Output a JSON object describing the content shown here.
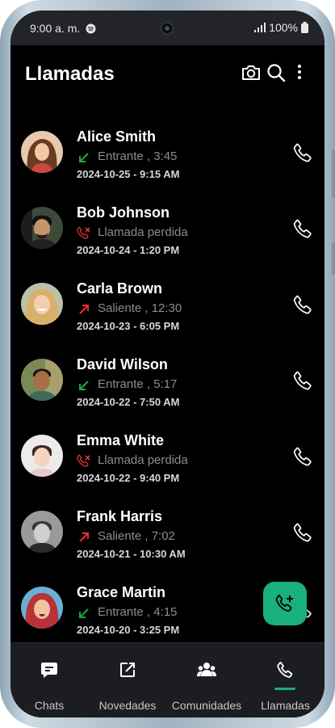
{
  "status_bar": {
    "time": "9:00 a. m.",
    "battery": "100%",
    "icons": [
      "spotify-icon",
      "signal-icon",
      "battery-icon"
    ]
  },
  "header": {
    "title": "Llamadas",
    "actions": [
      "camera-icon",
      "search-icon",
      "more-vert-icon"
    ]
  },
  "calls": [
    {
      "name": "Alice Smith",
      "direction": "incoming",
      "detail": "Entrante , 3:45",
      "datetime": "2024-10-25 - 9:15 AM"
    },
    {
      "name": "Bob Johnson",
      "direction": "missed",
      "detail": "Llamada perdida",
      "datetime": "2024-10-24 - 1:20 PM"
    },
    {
      "name": "Carla Brown",
      "direction": "outgoing",
      "detail": "Saliente , 12:30",
      "datetime": "2024-10-23 - 6:05 PM"
    },
    {
      "name": "David Wilson",
      "direction": "incoming",
      "detail": "Entrante , 5:17",
      "datetime": "2024-10-22 - 7:50 AM"
    },
    {
      "name": "Emma White",
      "direction": "missed",
      "detail": "Llamada perdida",
      "datetime": "2024-10-22 - 9:40 PM"
    },
    {
      "name": "Frank Harris",
      "direction": "outgoing",
      "detail": "Saliente , 7:02",
      "datetime": "2024-10-21 - 10:30 AM"
    },
    {
      "name": "Grace Martin",
      "direction": "incoming",
      "detail": "Entrante , 4:15",
      "datetime": "2024-10-20 - 3:25 PM"
    }
  ],
  "fab": {
    "icon": "add-call-icon"
  },
  "bottom_nav": [
    {
      "label": "Chats",
      "icon": "chat-bubble-icon"
    },
    {
      "label": "Novedades",
      "icon": "edit-square-icon"
    },
    {
      "label": "Comunidades",
      "icon": "groups-icon"
    },
    {
      "label": "Llamadas",
      "icon": "phone-icon",
      "active": true
    }
  ],
  "colors": {
    "accent": "#17b07e",
    "incoming": "#1faa3a",
    "missed": "#e3342f",
    "outgoing": "#e3342f",
    "background": "#000000",
    "nav_background": "#1c1d20"
  }
}
